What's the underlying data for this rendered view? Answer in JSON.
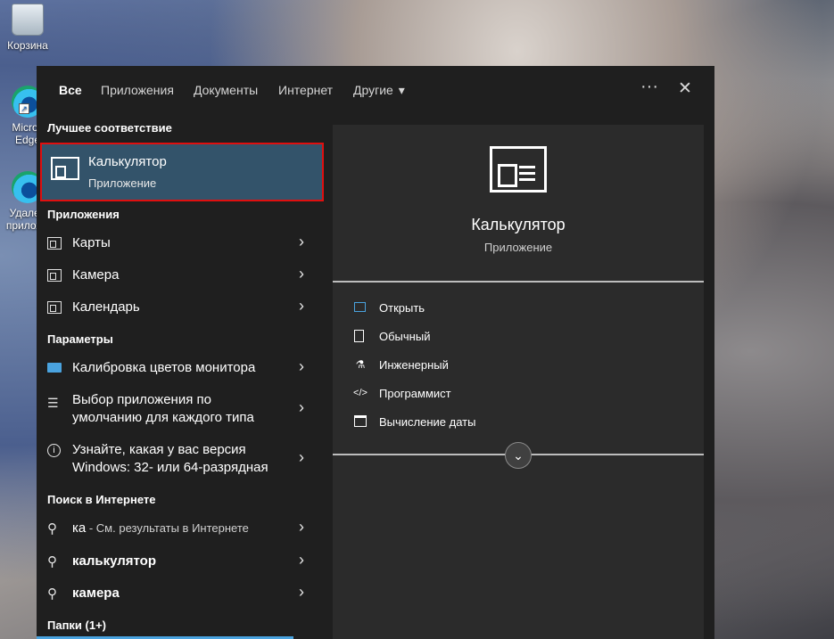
{
  "desktop": {
    "icons": [
      {
        "label": "Корзина"
      },
      {
        "label": "Micros\nEdge"
      },
      {
        "label": "Удален\nприложе"
      }
    ]
  },
  "tabs": [
    {
      "label": "Все"
    },
    {
      "label": "Приложения"
    },
    {
      "label": "Документы"
    },
    {
      "label": "Интернет"
    },
    {
      "label": "Другие"
    }
  ],
  "controls": {
    "more": "···",
    "close": "✕",
    "dropdown": "▾"
  },
  "sections": {
    "best_match": "Лучшее соответствие",
    "apps": "Приложения",
    "settings": "Параметры",
    "web": "Поиск в Интернете",
    "folders": "Папки (1+)"
  },
  "best_match": {
    "title": "Калькулятор",
    "subtitle": "Приложение"
  },
  "apps": [
    {
      "label": "Карты"
    },
    {
      "label": "Камера"
    },
    {
      "label": "Календарь"
    }
  ],
  "settings": [
    {
      "line1": "Калибровка цветов монитора"
    },
    {
      "line1": "Выбор приложения по",
      "line2": "умолчанию для каждого типа"
    },
    {
      "line1": "Узнайте, какая у вас версия",
      "line2": "Windows: 32- или 64-разрядная"
    }
  ],
  "web": [
    {
      "term": "ка",
      "hint": " - См. результаты в Интернете"
    },
    {
      "term": "калькулятор",
      "hint": ""
    },
    {
      "term": "камера",
      "hint": ""
    }
  ],
  "detail": {
    "title": "Калькулятор",
    "subtitle": "Приложение",
    "actions": [
      {
        "label": "Открыть",
        "icon": "open-icon"
      },
      {
        "label": "Обычный",
        "icon": "calculator-icon"
      },
      {
        "label": "Инженерный",
        "icon": "flask-icon"
      },
      {
        "label": "Программист",
        "icon": "code-icon"
      },
      {
        "label": "Вычисление даты",
        "icon": "calendar-icon"
      }
    ]
  },
  "chevron": "›",
  "expand": "⌄",
  "colors": {
    "accent": "#4aa3df",
    "highlight": "#33536a",
    "selection_border": "#e00f0f"
  }
}
